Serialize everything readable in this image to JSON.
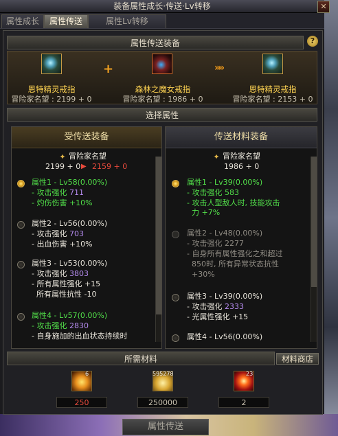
{
  "window": {
    "title": "装备属性成长·传送·Lv转移",
    "close_label": "✕"
  },
  "tabs": [
    {
      "label": "属性成长",
      "active": false
    },
    {
      "label": "属性传送",
      "active": true
    },
    {
      "label": "属性Lv转移",
      "active": false
    }
  ],
  "transfer_section": {
    "header": "属性传送装备",
    "help_label": "?",
    "source_item": {
      "name": "恩特精灵戒指",
      "reputation": "冒险家名望 : 2199 + 0"
    },
    "material_item": {
      "name": "森林之魔女戒指",
      "reputation": "冒险家名望 : 1986 + 0"
    },
    "result_item": {
      "name": "恩特精灵戒指",
      "reputation": "冒险家名望 : 2153 + 0"
    },
    "plus_symbol": "+",
    "arrow_symbol": "»»"
  },
  "select_section": {
    "header": "选择属性",
    "left": {
      "title": "受传送装备",
      "rep_label": "冒险家名望",
      "rep_before": "2199 + 0",
      "rep_after": "2159 + 0",
      "attributes": [
        {
          "radio": "selected",
          "name": "属性1 - Lv58(0.00%)",
          "lines": [
            {
              "label": "- 攻击强化",
              "value": "711"
            },
            {
              "label": "- 灼伤伤害 +10%"
            }
          ]
        },
        {
          "radio": "normal",
          "name": "属性2 - Lv56(0.00%)",
          "lines": [
            {
              "label": "- 攻击强化",
              "value": "703"
            },
            {
              "label": "- 出血伤害 +10%"
            }
          ]
        },
        {
          "radio": "normal",
          "name": "属性3 - Lv53(0.00%)",
          "lines": [
            {
              "label": "- 攻击强化",
              "value": "3803"
            },
            {
              "label": "- 所有属性强化 +15"
            },
            {
              "label": "  所有属性抗性 -10"
            }
          ]
        },
        {
          "radio": "normal",
          "name": "属性4 - Lv57(0.00%)",
          "lines": [
            {
              "label": "- 攻击强化",
              "value": "2830"
            },
            {
              "label": "- 自身施加的出血状态持续时"
            }
          ]
        }
      ]
    },
    "right": {
      "title": "传送材料装备",
      "rep_label": "冒险家名望",
      "rep_value": "1986 + 0",
      "attributes": [
        {
          "radio": "selected",
          "name": "属性1 - Lv39(0.00%)",
          "lines": [
            {
              "label": "- 攻击强化",
              "value": "583"
            },
            {
              "label": "- 攻击人型敌人时, 技能攻击"
            },
            {
              "label": "  力 +7%"
            }
          ]
        },
        {
          "radio": "disabled",
          "name": "属性2 - Lv48(0.00%)",
          "lines": [
            {
              "label": "- 攻击强化",
              "value": "2277"
            },
            {
              "label": "- 自身所有属性强化之和超过"
            },
            {
              "label": "  850时, 所有异常状态抗性"
            },
            {
              "label": "  +30%"
            }
          ]
        },
        {
          "radio": "normal",
          "name": "属性3 - Lv39(0.00%)",
          "lines": [
            {
              "label": "- 攻击强化",
              "value": "2333"
            },
            {
              "label": "- 光属性强化 +15"
            }
          ]
        },
        {
          "radio": "normal",
          "name": "属性4 - Lv56(0.00%)",
          "lines": []
        }
      ]
    }
  },
  "materials_section": {
    "header": "所需材料",
    "shop_button": "材料商店",
    "items": [
      {
        "badge": "6",
        "count": "250",
        "count_color": "#e84a3c"
      },
      {
        "badge": "595278",
        "count": "250000",
        "count_color": "#cfcfcf"
      },
      {
        "badge": "23",
        "count": "2",
        "count_color": "#cfcfcf"
      }
    ]
  },
  "footer": {
    "transfer_button": "属性传送"
  }
}
